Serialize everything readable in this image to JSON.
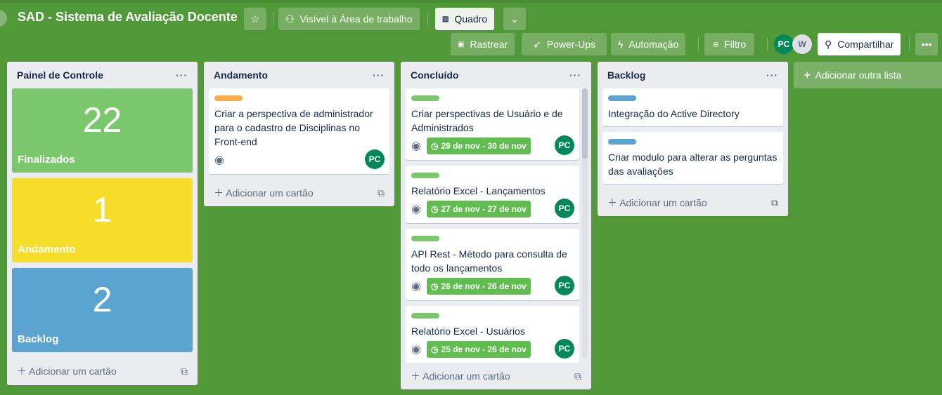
{
  "header": {
    "title": "SAD - Sistema de Avaliação Docente",
    "visibility": "Visível à Área de trabalho",
    "view": "Quadro",
    "rastrear": "Rastrear",
    "powerups": "Power-Ups",
    "automacao": "Automação",
    "filtro": "Filtro",
    "share": "Compartilhar",
    "members": [
      "PC",
      "W"
    ]
  },
  "add_list": "Adicionar outra lista",
  "add_card": "Adicionar um cartão",
  "colors": {
    "bg": "#519839",
    "green": "#7bc86c",
    "yellow": "#f5dd29",
    "blue": "#5ba4cf",
    "orange": "#ffab4a"
  },
  "lists": [
    {
      "title": "Painel de Controle",
      "stats": [
        {
          "value": "22",
          "label": "Finalizados"
        },
        {
          "value": "1",
          "label": "Andamento"
        },
        {
          "value": "2",
          "label": "Backlog"
        }
      ]
    },
    {
      "title": "Andamento",
      "cards": [
        {
          "title": "Criar a perspectiva de administrador para o cadastro de Disciplinas no Front-end",
          "member": "PC"
        }
      ]
    },
    {
      "title": "Concluído",
      "cards": [
        {
          "title": "Criar perspectivas de Usuário e de Administrados",
          "due": "29 de nov - 30 de nov",
          "member": "PC"
        },
        {
          "title": "Relatório Excel - Lançamentos",
          "due": "27 de nov - 27 de nov",
          "member": "PC"
        },
        {
          "title": "API Rest - Método para consulta de todo os lançamentos",
          "due": "26 de nov - 26 de nov",
          "member": "PC"
        },
        {
          "title": "Relatório Excel - Usuários",
          "due": "25 de nov - 26 de nov",
          "member": "PC"
        }
      ]
    },
    {
      "title": "Backlog",
      "cards": [
        {
          "title": "Integração do Active Directory"
        },
        {
          "title": "Criar modulo para alterar as perguntas das avaliações"
        }
      ]
    }
  ]
}
